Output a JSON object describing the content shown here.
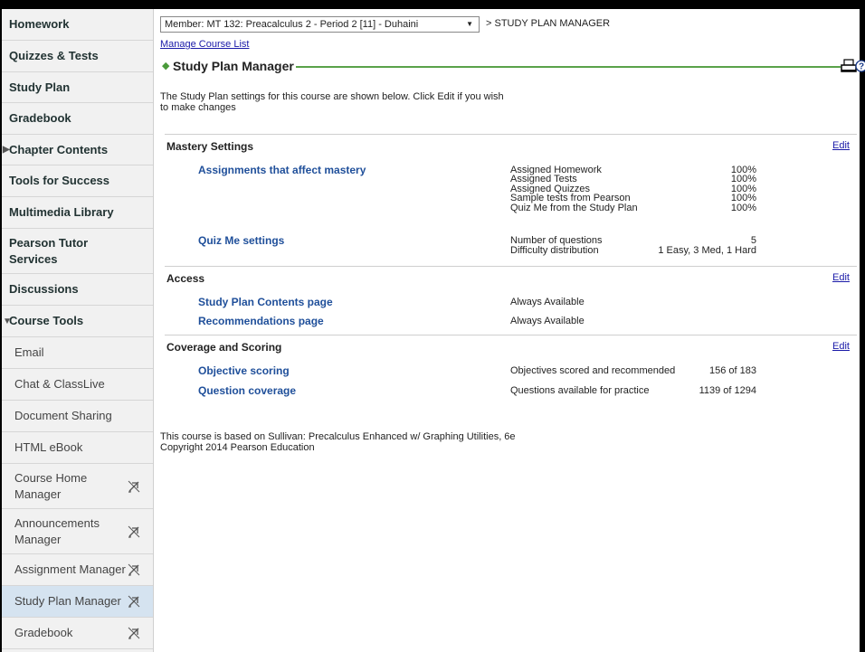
{
  "sidebar": {
    "items": [
      {
        "label": "Homework"
      },
      {
        "label": "Quizzes & Tests"
      },
      {
        "label": "Study Plan"
      },
      {
        "label": "Gradebook"
      },
      {
        "label": "Chapter Contents"
      },
      {
        "label": "Tools for Success"
      },
      {
        "label": "Multimedia Library"
      },
      {
        "label": "Pearson Tutor Services"
      },
      {
        "label": "Discussions"
      },
      {
        "label": "Course Tools"
      },
      {
        "label": "Email"
      },
      {
        "label": "Chat & ClassLive"
      },
      {
        "label": "Document Sharing"
      },
      {
        "label": "HTML eBook"
      },
      {
        "label": "Course Home Manager"
      },
      {
        "label": "Announcements Manager"
      },
      {
        "label": "Assignment Manager"
      },
      {
        "label": "Study Plan Manager"
      },
      {
        "label": "Gradebook"
      }
    ]
  },
  "header": {
    "member_select": "Member: MT 132: Preacalculus 2 - Period 2 [11] - Duhaini",
    "breadcrumb": "> STUDY PLAN MANAGER",
    "manage_link": "Manage Course List",
    "page_title": "Study Plan Manager",
    "intro": "The Study Plan settings for this course are shown below. Click Edit if you wish to make changes"
  },
  "mastery": {
    "heading": "Mastery Settings",
    "edit": "Edit",
    "assignments_label": "Assignments that affect mastery",
    "assignments": [
      {
        "name": "Assigned Homework",
        "value": "100%"
      },
      {
        "name": "Assigned Tests",
        "value": "100%"
      },
      {
        "name": "Assigned Quizzes",
        "value": "100%"
      },
      {
        "name": "Sample tests from Pearson",
        "value": "100%"
      },
      {
        "name": "Quiz Me from the Study Plan",
        "value": "100%"
      }
    ],
    "quizme_label": "Quiz Me settings",
    "quizme": [
      {
        "name": "Number of questions",
        "value": "5"
      },
      {
        "name": "Difficulty distribution",
        "value": "1 Easy, 3 Med, 1 Hard"
      }
    ]
  },
  "access": {
    "heading": "Access",
    "edit": "Edit",
    "rows": [
      {
        "label": "Study Plan Contents page",
        "value": "Always Available"
      },
      {
        "label": "Recommendations page",
        "value": "Always Available"
      }
    ]
  },
  "coverage": {
    "heading": "Coverage and Scoring",
    "edit": "Edit",
    "rows": [
      {
        "label": "Objective scoring",
        "name": "Objectives scored and recommended",
        "value": "156 of 183"
      },
      {
        "label": "Question coverage",
        "name": "Questions available for practice",
        "value": "1139 of 1294"
      }
    ]
  },
  "footer": {
    "line1": "This course is based on Sullivan: Precalculus Enhanced w/ Graphing Utilities, 6e",
    "line2": "Copyright 2014 Pearson Education"
  }
}
